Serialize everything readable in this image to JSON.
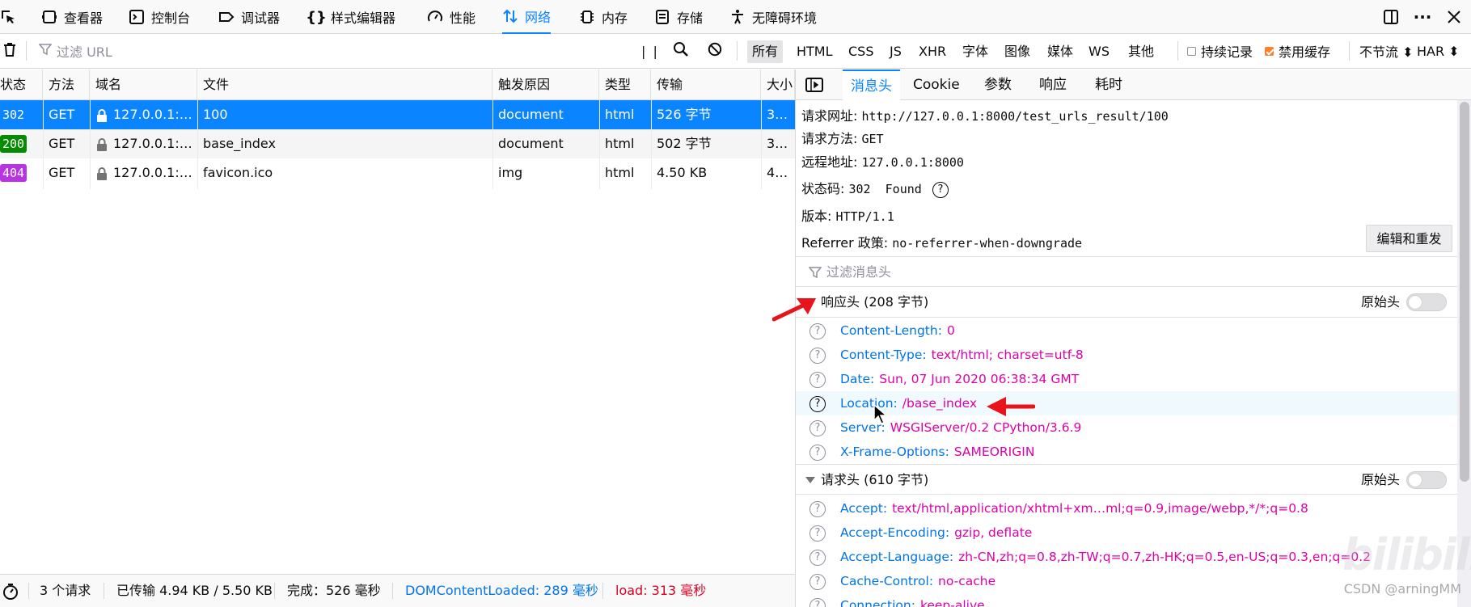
{
  "toolbar": {
    "tools": [
      {
        "name": "pick-element",
        "label": ""
      },
      {
        "name": "inspector",
        "label": "查看器"
      },
      {
        "name": "console",
        "label": "控制台"
      },
      {
        "name": "debugger",
        "label": "调试器"
      },
      {
        "name": "style-editor",
        "label": "样式编辑器"
      },
      {
        "name": "performance",
        "label": "性能"
      },
      {
        "name": "network",
        "label": "网络"
      },
      {
        "name": "memory",
        "label": "内存"
      },
      {
        "name": "storage",
        "label": "存储"
      },
      {
        "name": "accessibility",
        "label": "无障碍环境"
      }
    ]
  },
  "filterbar": {
    "url_placeholder": "过滤 URL",
    "types": [
      "所有",
      "HTML",
      "CSS",
      "JS",
      "XHR",
      "字体",
      "图像",
      "媒体",
      "WS",
      "其他"
    ],
    "selected_type": "所有",
    "persist_logs": "持续记录",
    "disable_cache": "禁用缓存",
    "throttling": "不节流 ⬍",
    "har": "HAR ⬍"
  },
  "table": {
    "headers": [
      "状态",
      "方法",
      "域名",
      "文件",
      "触发原因",
      "类型",
      "传输",
      "大小"
    ],
    "rows": [
      {
        "status": "302",
        "status_color": "#0a84ff",
        "method": "GET",
        "domain": "127.0.0.1:…",
        "file": "100",
        "cause": "document",
        "type": "html",
        "transferred": "526 字节",
        "size": "3…"
      },
      {
        "status": "200",
        "status_color": "#058b00",
        "method": "GET",
        "domain": "127.0.0.1:…",
        "file": "base_index",
        "cause": "document",
        "type": "html",
        "transferred": "502 字节",
        "size": "3…"
      },
      {
        "status": "404",
        "status_color": "#b833e1",
        "method": "GET",
        "domain": "127.0.0.1:…",
        "file": "favicon.ico",
        "cause": "img",
        "type": "html",
        "transferred": "4.50 KB",
        "size": "4…"
      }
    ]
  },
  "statusbar": {
    "requests": "3 个请求",
    "transferred": "已传输 4.94 KB / 5.50 KB",
    "finish": "完成：526 毫秒",
    "dom_content_loaded": "DOMContentLoaded: 289 毫秒",
    "load": "load: 313 毫秒",
    "dcl_color": "#0074e8",
    "load_color": "#d70022"
  },
  "panel": {
    "tabs": [
      "消息头",
      "Cookie",
      "参数",
      "响应",
      "耗时"
    ],
    "active_tab": "消息头",
    "summary": {
      "url_label": "请求网址:",
      "url_value": "http://127.0.0.1:8000/test_urls_result/100",
      "method_label": "请求方法:",
      "method_value": "GET",
      "remote_label": "远程地址:",
      "remote_value": "127.0.0.1:8000",
      "status_label": "状态码:",
      "status_value": "302  Found",
      "version_label": "版本:",
      "version_value": "HTTP/1.1",
      "referrer_label": "Referrer 政策:",
      "referrer_value": "no-referrer-when-downgrade"
    },
    "edit_resend": "编辑和重发",
    "filter_headers_placeholder": "过滤消息头",
    "response_headers": {
      "title": "响应头 (208 字节)",
      "raw_label": "原始头",
      "items": [
        {
          "name": "Content-Length:",
          "value": "0"
        },
        {
          "name": "Content-Type:",
          "value": "text/html; charset=utf-8"
        },
        {
          "name": "Date:",
          "value": "Sun, 07 Jun 2020 06:38:34 GMT"
        },
        {
          "name": "Location:",
          "value": "/base_index"
        },
        {
          "name": "Server:",
          "value": "WSGIServer/0.2 CPython/3.6.9"
        },
        {
          "name": "X-Frame-Options:",
          "value": "SAMEORIGIN"
        }
      ]
    },
    "request_headers": {
      "title": "请求头 (610 字节)",
      "raw_label": "原始头",
      "items": [
        {
          "name": "Accept:",
          "value": "text/html,application/xhtml+xm…ml;q=0.9,image/webp,*/*;q=0.8"
        },
        {
          "name": "Accept-Encoding:",
          "value": "gzip, deflate"
        },
        {
          "name": "Accept-Language:",
          "value": "zh-CN,zh;q=0.8,zh-TW;q=0.7,zh-HK;q=0.5,en-US;q=0.3,en;q=0.2"
        },
        {
          "name": "Cache-Control:",
          "value": "no-cache"
        },
        {
          "name": "Connection:",
          "value": "keep-alive"
        }
      ]
    }
  },
  "watermark": "CSDN @arningMM",
  "watermark_logo": "bilibili"
}
